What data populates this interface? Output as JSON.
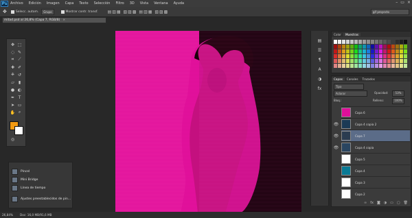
{
  "menubar": {
    "logo": "Ps",
    "items": [
      "Archivo",
      "Edición",
      "Imagen",
      "Capa",
      "Texto",
      "Selección",
      "Filtro",
      "3D",
      "Vista",
      "Ventana",
      "Ayuda"
    ],
    "win_controls": [
      "–",
      "▭",
      "×"
    ]
  },
  "options": {
    "select_value": "Selecc. autom.",
    "select_target": "Grupo",
    "transform_label": "Mostrar contr. transf.",
    "workspace": "gif proyecto"
  },
  "document": {
    "tab_title": "mitad.psd al 26,8% (Capa 7, RGB/8)",
    "close": "×"
  },
  "popup": {
    "items": [
      "Pincel",
      "Mini Bridge",
      "Línea de tiempo",
      "Ajustes preestablecidos de pin..."
    ]
  },
  "panels": {
    "swatch_tabs": [
      "Color",
      "Muestras"
    ],
    "layers_tabs": [
      "Capas",
      "Canales",
      "Trazados"
    ],
    "kind_label": "Tipo",
    "blend_mode": "Aclarar",
    "opacity_label": "Opacidad:",
    "opacity_value": "53%",
    "lock_label": "Bloq.:",
    "fill_label": "Relleno:",
    "fill_value": "100%",
    "layers": [
      {
        "name": "Capa 6",
        "visible": false,
        "thumb": "#e0109a"
      },
      {
        "name": "Capa 4 copia 2",
        "visible": true,
        "thumb": "#1b3a55"
      },
      {
        "name": "Capa 7",
        "visible": true,
        "thumb": "#2b3c50"
      },
      {
        "name": "Capa 4 copia",
        "visible": true,
        "thumb": "#2a4560"
      },
      {
        "name": "Capa 5",
        "visible": false,
        "thumb": "#ffffff"
      },
      {
        "name": "Capa 4",
        "visible": false,
        "thumb": "#0a7a95"
      },
      {
        "name": "Capa 3",
        "visible": false,
        "thumb": "#ffffff"
      },
      {
        "name": "Capa 2",
        "visible": false,
        "thumb": "#ffffff"
      }
    ],
    "selected_layer": "Capa 7"
  },
  "status": {
    "zoom": "26,84%",
    "doc_size": "Doc: 16,0 MB/91,6 MB"
  },
  "colors": {
    "foreground": "#f29a12",
    "background": "#ffffff",
    "canvas_pink": "#e0109a"
  }
}
